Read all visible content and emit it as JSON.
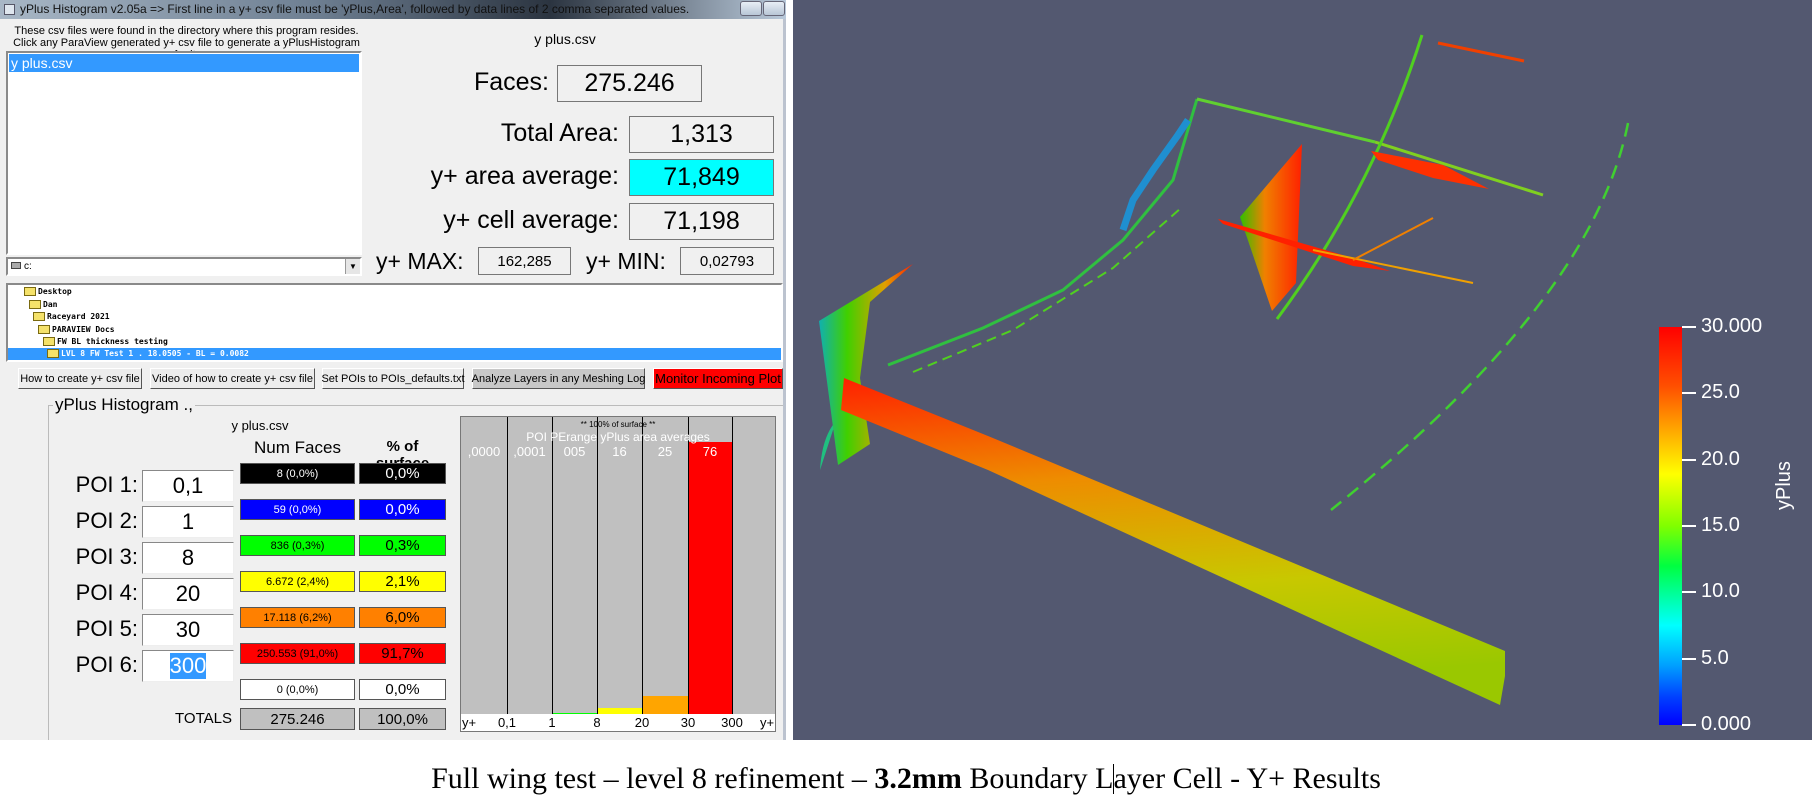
{
  "window": {
    "title": "yPlus Histogram v2.05a => First line in a y+ csv file must be 'yPlus,Area', followed by data lines of 2 comma separated values.",
    "instructions": [
      "These csv files were found in the directory where this program resides.",
      "Click any ParaView generated y+ csv file to generate a yPlusHistogram for it."
    ],
    "file_list": [
      "y plus.csv"
    ],
    "drive": "c:"
  },
  "stats": {
    "file_label": "y plus.csv",
    "faces_label": "Faces:",
    "faces": "275.246",
    "total_area_label": "Total Area:",
    "total_area": "1,313",
    "area_avg_label": "y+ area average:",
    "area_avg": "71,849",
    "cell_avg_label": "y+ cell average:",
    "cell_avg": "71,198",
    "max_label": "y+ MAX:",
    "max": "162,285",
    "min_label": "y+ MIN:",
    "min": "0,02793",
    "highlight_color": "#00ffff"
  },
  "tree": {
    "items": [
      "Desktop",
      "Dan",
      "Raceyard 2021",
      "PARAVIEW Docs",
      "FW BL thickness testing",
      "LVL 8 FW Test 1 . 18.0505 - BL = 0.0082"
    ],
    "selected": 5
  },
  "buttons": [
    "How to create y+ csv file",
    "Video of how to create y+ csv file",
    "Set POIs to POIs_defaults.txt",
    "Analyze Layers in any Meshing Log",
    "Monitor Incoming Plot"
  ],
  "histogram": {
    "group_title": "yPlus Histogram .,",
    "file_label": "y plus.csv",
    "col_num_faces": "Num Faces",
    "col_pct": "% of surface",
    "pois": [
      {
        "label": "POI 1:",
        "value": "0,1"
      },
      {
        "label": "POI 2:",
        "value": "1"
      },
      {
        "label": "POI 3:",
        "value": "8"
      },
      {
        "label": "POI 4:",
        "value": "20"
      },
      {
        "label": "POI 5:",
        "value": "30"
      },
      {
        "label": "POI 6:",
        "value": "300"
      }
    ],
    "rows": [
      {
        "num": "8 (0,0%)",
        "pct": "0,0%",
        "bg": "#000000",
        "fg": "#ffffff"
      },
      {
        "num": "59 (0,0%)",
        "pct": "0,0%",
        "bg": "#0000ff",
        "fg": "#ffffff"
      },
      {
        "num": "836 (0,3%)",
        "pct": "0,3%",
        "bg": "#00ff00",
        "fg": "#000000"
      },
      {
        "num": "6.672 (2,4%)",
        "pct": "2,1%",
        "bg": "#ffff00",
        "fg": "#000000"
      },
      {
        "num": "17.118 (6,2%)",
        "pct": "6,0%",
        "bg": "#ff8000",
        "fg": "#000000"
      },
      {
        "num": "250.553 (91,0%)",
        "pct": "91,7%",
        "bg": "#ff0000",
        "fg": "#000000"
      },
      {
        "num": "0 (0,0%)",
        "pct": "0,0%",
        "bg": "#ffffff",
        "fg": "#000000"
      }
    ],
    "totals_label": "TOTALS",
    "totals_num": "275.246",
    "totals_pct": "100,0%"
  },
  "chart_data": {
    "type": "bar",
    "title": "** 100% of surface **",
    "subtitle": "POI PErange yPlus area averages",
    "range_averages": [
      ",0000",
      ",0001",
      "005",
      "16",
      "25",
      "76",
      ""
    ],
    "x_tick_labels": [
      "y+",
      "0,1",
      "1",
      "8",
      "20",
      "30",
      "300",
      "y+"
    ],
    "values_pct": [
      0.0,
      0.0,
      0.3,
      2.1,
      6.0,
      91.7,
      0.0
    ],
    "colors": [
      "#000000",
      "#0000ff",
      "#00ff00",
      "#ffff00",
      "#ffa500",
      "#ff0000",
      "#ffffff"
    ],
    "ylim": [
      0,
      100
    ]
  },
  "viewer": {
    "colorbar_title": "yPlus",
    "colorbar_ticks": [
      "30.000",
      "25.0",
      "20.0",
      "15.0",
      "10.0",
      "5.0",
      "0.000"
    ],
    "range": [
      0,
      30
    ]
  },
  "caption": {
    "part1": "Full wing test – level 8 refinement – ",
    "bold": "3.2mm",
    "part2": " Boundary L",
    "part3": "ayer Cell - Y+ Results"
  }
}
